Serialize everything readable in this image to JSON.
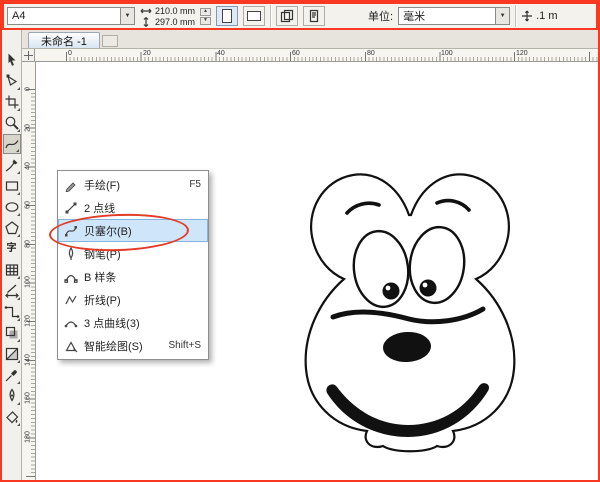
{
  "window": {
    "border_color": "#f93822"
  },
  "property_bar": {
    "paper_preset": "A4",
    "paper_width": "210.0 mm",
    "paper_height": "297.0 mm",
    "units_label": "单位:",
    "units_value": "毫米",
    "nudge_value": ".1 m"
  },
  "icons": {
    "dropdown": "▼",
    "spin_up": "▲",
    "spin_down": "▼"
  },
  "tab_bar": {
    "document_tab": "未命名 -1"
  },
  "rulers": {
    "horizontal": [
      "0",
      "20",
      "40",
      "60",
      "80",
      "100",
      "120"
    ],
    "vertical": [
      "0",
      "20",
      "40",
      "60",
      "80",
      "100",
      "120",
      "140",
      "160",
      "180"
    ]
  },
  "toolbox": {
    "active_tool": "freehand-tool",
    "text_tool_glyph": "字",
    "tools": [
      "pick-tool",
      "shape-tool",
      "crop-tool",
      "zoom-tool",
      "freehand-tool",
      "artistic-media-tool",
      "rectangle-tool",
      "ellipse-tool",
      "polygon-tool",
      "text-tool",
      "table-tool",
      "parallel-dimension-tool",
      "connector-tool",
      "drop-shadow-tool",
      "transparency-tool",
      "color-eyedropper-tool",
      "outline-pen-tool",
      "smart-fill-tool"
    ]
  },
  "flyout_menu": {
    "highlight_color": "#cfe6fa",
    "annotation_color": "#e23b28",
    "items": [
      {
        "label": "手绘(F)",
        "shortcut": "F5",
        "icon": "freehand-icon"
      },
      {
        "label": "2 点线",
        "shortcut": "",
        "icon": "two-point-line-icon"
      },
      {
        "label": "贝塞尔(B)",
        "shortcut": "",
        "icon": "bezier-icon"
      },
      {
        "label": "钢笔(P)",
        "shortcut": "",
        "icon": "pen-icon"
      },
      {
        "label": "B 样条",
        "shortcut": "",
        "icon": "b-spline-icon"
      },
      {
        "label": "折线(P)",
        "shortcut": "",
        "icon": "polyline-icon"
      },
      {
        "label": "3 点曲线(3)",
        "shortcut": "",
        "icon": "three-point-curve-icon"
      },
      {
        "label": "智能绘图(S)",
        "shortcut": "Shift+S",
        "icon": "smart-drawing-icon"
      }
    ]
  },
  "canvas": {
    "drawing": "cartoon-mouse-face"
  }
}
